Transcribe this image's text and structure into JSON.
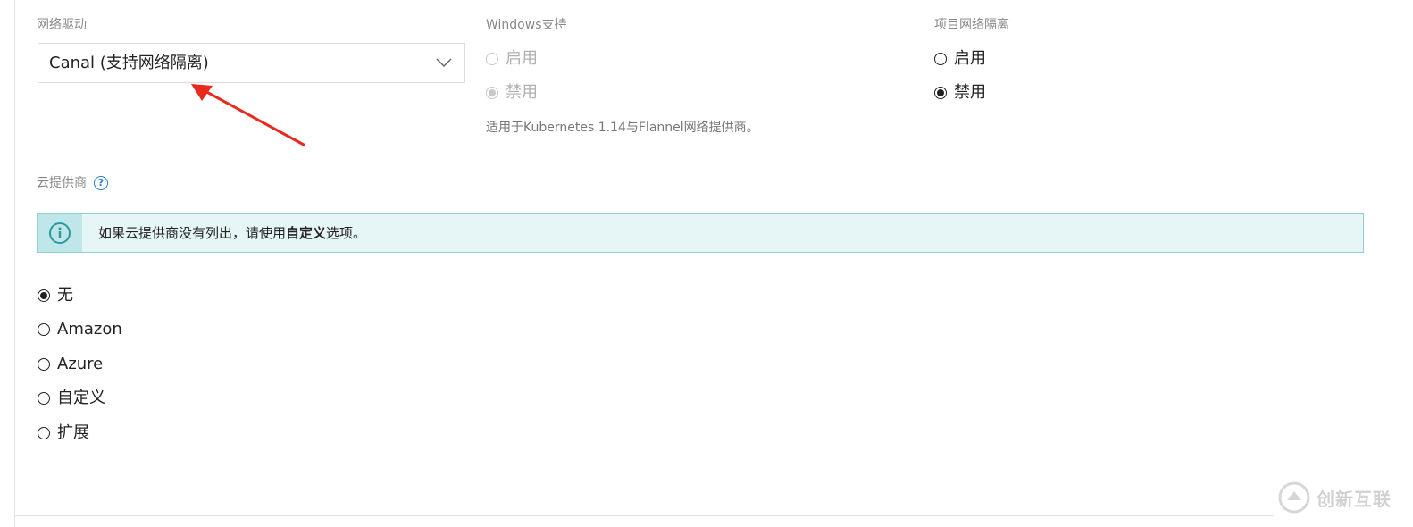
{
  "network": {
    "label": "网络驱动",
    "selected": "Canal (支持网络隔离)"
  },
  "windows_support": {
    "label": "Windows支持",
    "options": [
      {
        "label": "启用",
        "checked": false,
        "disabled": true
      },
      {
        "label": "禁用",
        "checked": true,
        "disabled": true
      }
    ],
    "help": "适用于Kubernetes 1.14与Flannel网络提供商。"
  },
  "project_isolation": {
    "label": "项目网络隔离",
    "options": [
      {
        "label": "启用",
        "checked": false
      },
      {
        "label": "禁用",
        "checked": true
      }
    ]
  },
  "cloud_provider": {
    "label": "云提供商",
    "help_icon": "question-icon",
    "banner": {
      "icon": "info-icon",
      "text_before": "如果云提供商没有列出，请使用",
      "text_bold": "自定义",
      "text_after": "选项。"
    },
    "options": [
      {
        "label": "无",
        "checked": true
      },
      {
        "label": "Amazon",
        "checked": false
      },
      {
        "label": "Azure",
        "checked": false
      },
      {
        "label": "自定义",
        "checked": false
      },
      {
        "label": "扩展",
        "checked": false
      }
    ]
  },
  "watermark": {
    "text": "创新互联",
    "logo": "brand-logo-icon"
  },
  "colors": {
    "annotation_arrow": "#e8291c",
    "banner_bg": "#e6f6f6",
    "banner_border": "#92cfd2",
    "info_icon": "#2a9aa0",
    "help_icon": "#2a7fc4"
  }
}
